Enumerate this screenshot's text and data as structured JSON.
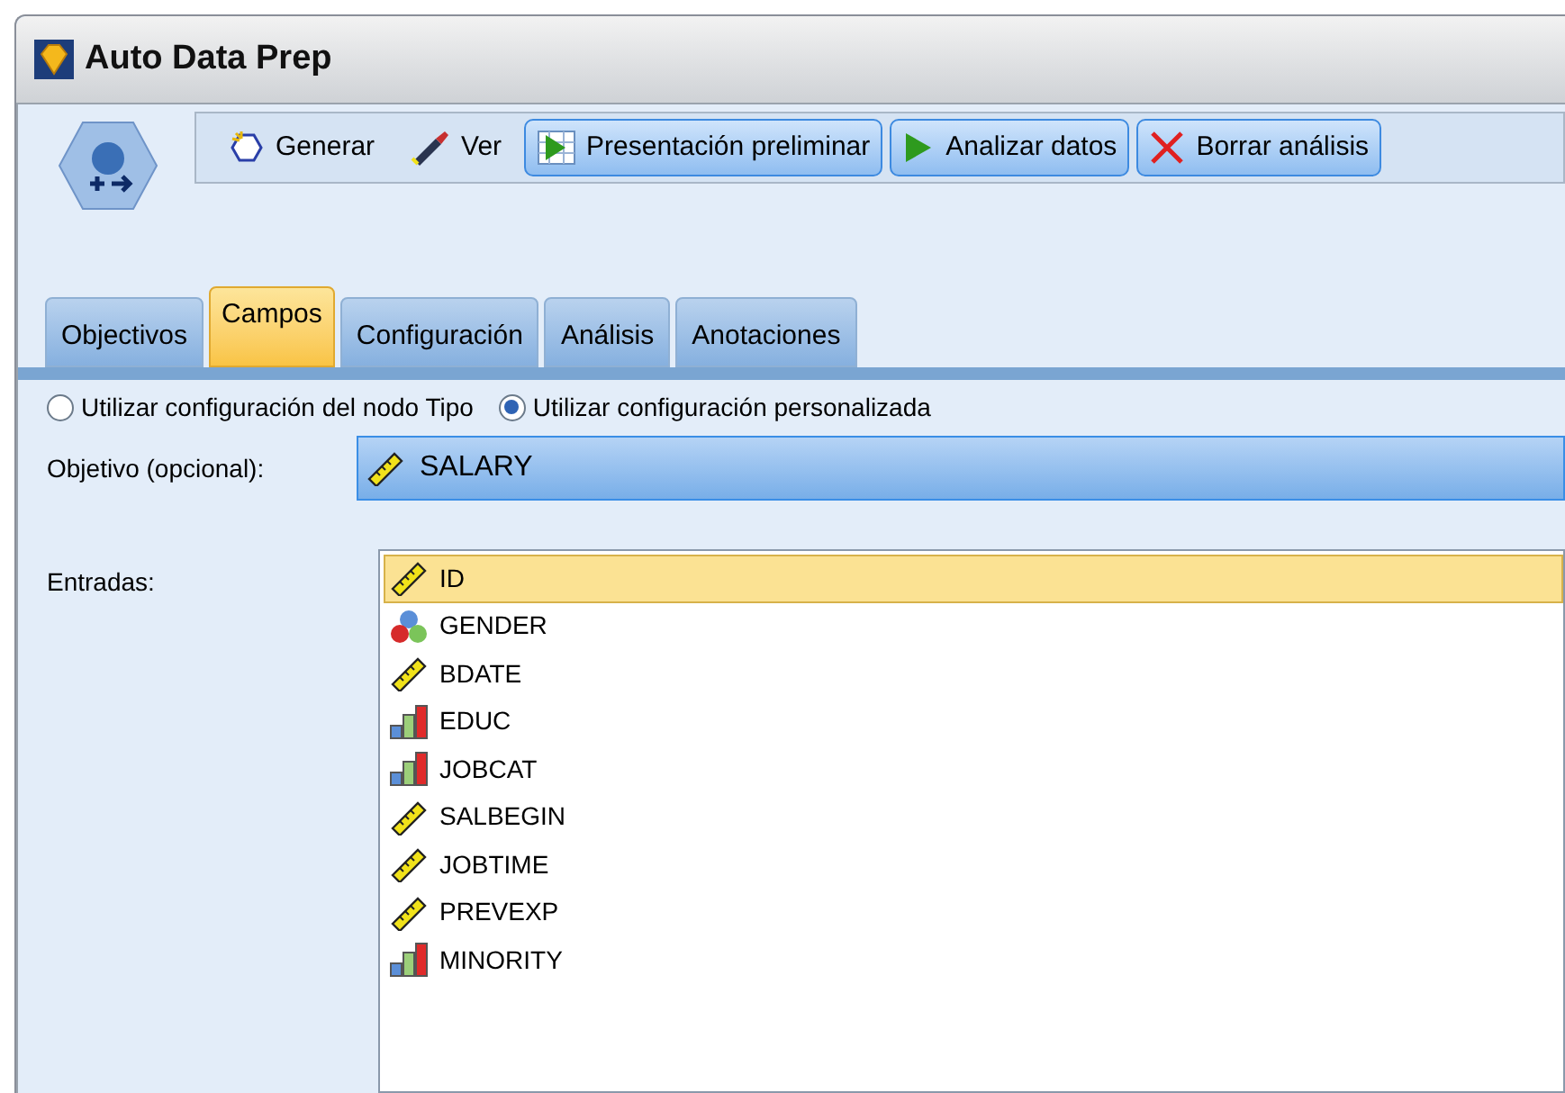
{
  "window": {
    "title": "Auto Data Prep"
  },
  "toolbar": [
    {
      "label": "Generar",
      "kind": "plain"
    },
    {
      "label": "Ver",
      "kind": "plain"
    },
    {
      "label": "Presentación preliminar",
      "kind": "raised"
    },
    {
      "label": "Analizar datos",
      "kind": "raised"
    },
    {
      "label": "Borrar análisis",
      "kind": "raised"
    }
  ],
  "tabs": [
    {
      "label": "Objectivos",
      "selected": false
    },
    {
      "label": "Campos",
      "selected": true
    },
    {
      "label": "Configuración",
      "selected": false
    },
    {
      "label": "Análisis",
      "selected": false
    },
    {
      "label": "Anotaciones",
      "selected": false
    }
  ],
  "radios": [
    {
      "label": "Utilizar configuración del nodo Tipo",
      "selected": false
    },
    {
      "label": "Utilizar configuración personalizada",
      "selected": true
    }
  ],
  "target": {
    "label": "Objetivo (opcional):",
    "value": "SALARY",
    "kind": "continuous"
  },
  "inputs": {
    "label": "Entradas:",
    "fields": [
      {
        "name": "ID",
        "kind": "continuous",
        "selected": true
      },
      {
        "name": "GENDER",
        "kind": "nominal",
        "selected": false
      },
      {
        "name": "BDATE",
        "kind": "continuous",
        "selected": false
      },
      {
        "name": "EDUC",
        "kind": "ordinal",
        "selected": false
      },
      {
        "name": "JOBCAT",
        "kind": "ordinal",
        "selected": false
      },
      {
        "name": "SALBEGIN",
        "kind": "continuous",
        "selected": false
      },
      {
        "name": "JOBTIME",
        "kind": "continuous",
        "selected": false
      },
      {
        "name": "PREVEXP",
        "kind": "continuous",
        "selected": false
      },
      {
        "name": "MINORITY",
        "kind": "ordinal",
        "selected": false
      }
    ]
  }
}
